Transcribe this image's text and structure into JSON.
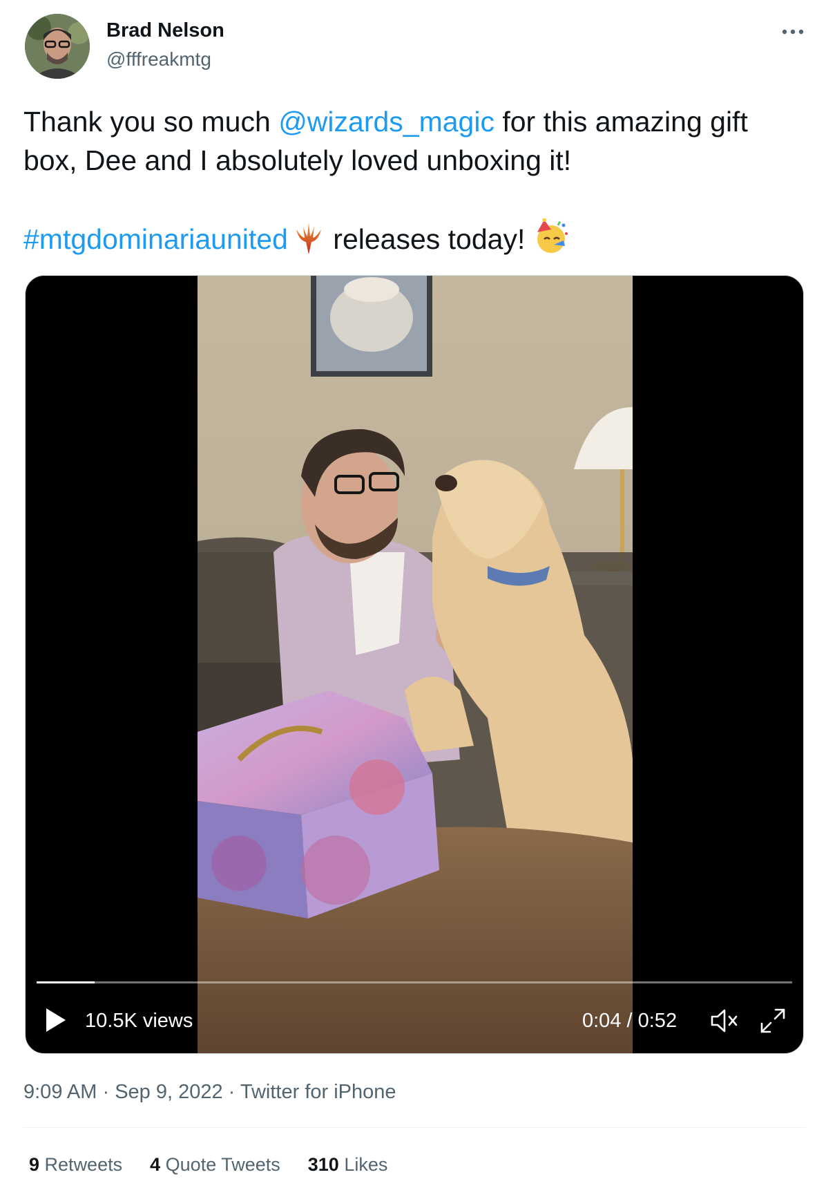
{
  "author": {
    "display_name": "Brad Nelson",
    "handle": "@fffreakmtg"
  },
  "tweet": {
    "text_part1": "Thank you so much ",
    "mention": "@wizards_magic",
    "text_part2": " for this amazing gift box, Dee and I absolutely loved unboxing it!",
    "hashtag": "#mtgdominariaunited",
    "text_part3": " releases today! "
  },
  "video": {
    "views": "10.5K views",
    "current_time": "0:04",
    "duration": "0:52",
    "time_separator": " / ",
    "progress": 0.077
  },
  "meta": {
    "time": "9:09 AM",
    "date": "Sep 9, 2022",
    "client": "Twitter for iPhone",
    "sep": " · "
  },
  "stats": {
    "retweets_count": "9",
    "retweets_label": "Retweets",
    "quotes_count": "4",
    "quotes_label": "Quote Tweets",
    "likes_count": "310",
    "likes_label": "Likes"
  },
  "colors": {
    "link": "#1d9bf0",
    "secondary_text": "#536471",
    "primary_text": "#0f1419"
  },
  "icons": [
    "more-icon",
    "mtg-planeswalker-icon",
    "party-face-emoji",
    "play-icon",
    "mute-icon",
    "fullscreen-icon"
  ]
}
